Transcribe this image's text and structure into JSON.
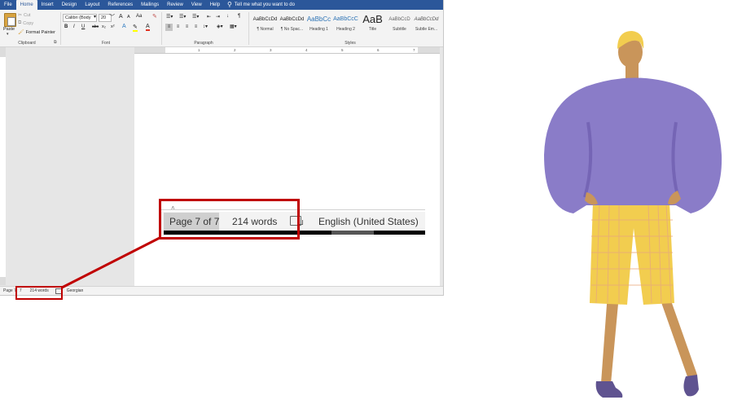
{
  "ribbon": {
    "tabs": [
      "File",
      "Home",
      "Insert",
      "Design",
      "Layout",
      "References",
      "Mailings",
      "Review",
      "View",
      "Help"
    ],
    "active_tab": "Home",
    "tell_me": "Tell me what you want to do",
    "clipboard": {
      "paste": "Paste",
      "cut": "Cut",
      "copy": "Copy",
      "format_painter": "Format Painter",
      "group_label": "Clipboard"
    },
    "font": {
      "name": "Calibri (Body",
      "size": "20",
      "grow": "A",
      "shrink": "A",
      "change_case": "Aa",
      "bold": "B",
      "italic": "I",
      "underline": "U",
      "strike": "abc",
      "subscript": "x₂",
      "superscript": "x²",
      "group_label": "Font"
    },
    "paragraph": {
      "group_label": "Paragraph"
    },
    "styles": {
      "group_label": "Styles",
      "items": [
        {
          "sample": "AaBbCcDd",
          "name": "¶ Normal"
        },
        {
          "sample": "AaBbCcDd",
          "name": "¶ No Spac..."
        },
        {
          "sample": "AaBbCc",
          "name": "Heading 1"
        },
        {
          "sample": "AaBbCcC",
          "name": "Heading 2"
        },
        {
          "sample": "AaB",
          "name": "Title"
        },
        {
          "sample": "AaBbCcD",
          "name": "Subtitle"
        },
        {
          "sample": "AaBbCcDd",
          "name": "Subtle Em..."
        }
      ]
    }
  },
  "ruler": {
    "numbers": [
      "1",
      "2",
      "3",
      "4",
      "5",
      "6",
      "7"
    ]
  },
  "statusbar": {
    "page": "Page 7",
    "page_suffix": "7",
    "words": "214 words",
    "language": "Georgian"
  },
  "zoom": {
    "page": "Page 7 of 7",
    "words": "214 words",
    "language": "English (United States)"
  },
  "colors": {
    "word_blue": "#2b579a",
    "highlight_red": "#c00000",
    "sweater": "#8a7cc8",
    "pants": "#f2cd4f",
    "skin": "#c9955a",
    "hair": "#f2cd4f",
    "shoes": "#5f5390"
  }
}
